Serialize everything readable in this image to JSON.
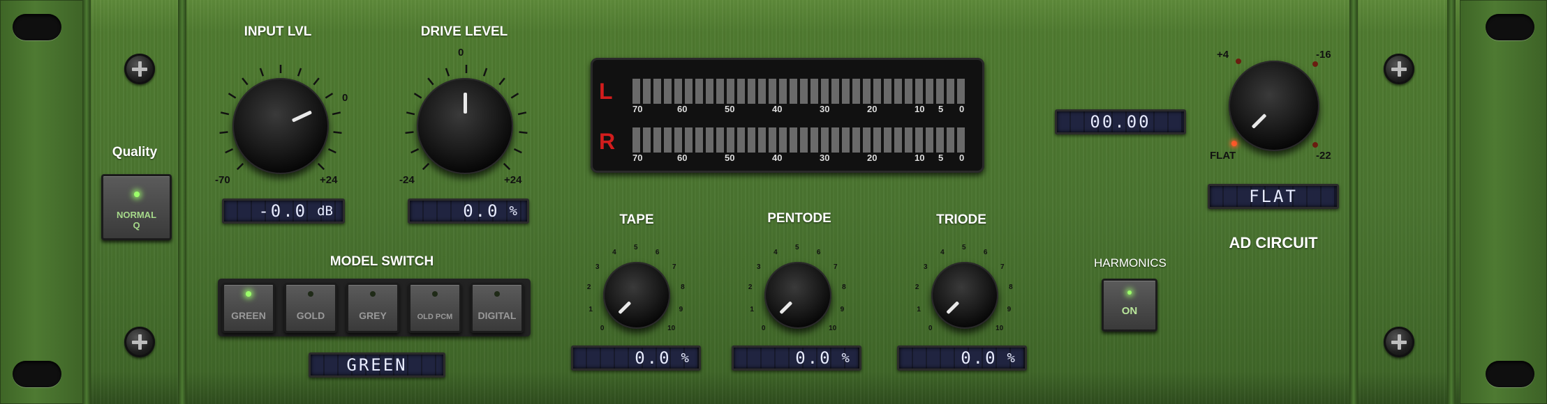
{
  "quality": {
    "label": "Quality",
    "button_line1": "NORMAL",
    "button_line2": "Q"
  },
  "input": {
    "label": "INPUT LVL",
    "min": "-70",
    "max": "+24",
    "mark": "0",
    "value": "-0.0",
    "unit": "dB"
  },
  "drive": {
    "label": "DRIVE LEVEL",
    "min": "-24",
    "max": "+24",
    "mark": "0",
    "value": "0.0",
    "unit": "%"
  },
  "meter": {
    "left_label": "L",
    "right_label": "R",
    "scale": [
      "70",
      "60",
      "50",
      "40",
      "30",
      "20",
      "10",
      "5",
      "0"
    ]
  },
  "model_switch": {
    "label": "MODEL SWITCH",
    "buttons": [
      "GREEN",
      "GOLD",
      "GREY",
      "OLD PCM",
      "DIGITAL"
    ],
    "selected": "GREEN",
    "display": "GREEN"
  },
  "knob_scale": [
    "0",
    "1",
    "2",
    "3",
    "4",
    "5",
    "6",
    "7",
    "8",
    "9",
    "10"
  ],
  "tape": {
    "label": "TAPE",
    "value": "0.0",
    "unit": "%"
  },
  "pentode": {
    "label": "PENTODE",
    "value": "0.0",
    "unit": "%"
  },
  "triode": {
    "label": "TRIODE",
    "value": "0.0",
    "unit": "%"
  },
  "harmonics": {
    "label": "HARMONICS",
    "button": "ON"
  },
  "readout": {
    "value": "00.00"
  },
  "ad_circuit": {
    "label": "AD CIRCUIT",
    "marks": {
      "top_left": "+4",
      "top_right": "-16",
      "bottom_left": "FLAT",
      "bottom_right": "-22"
    },
    "display": "FLAT"
  },
  "colors": {
    "panel": "#4a7430",
    "led_green": "#9cff6a",
    "meter_letter": "#d21d1d",
    "lcd_text": "#e8ecff"
  },
  "icons": [
    "screw-icon",
    "rack-slot-icon"
  ]
}
